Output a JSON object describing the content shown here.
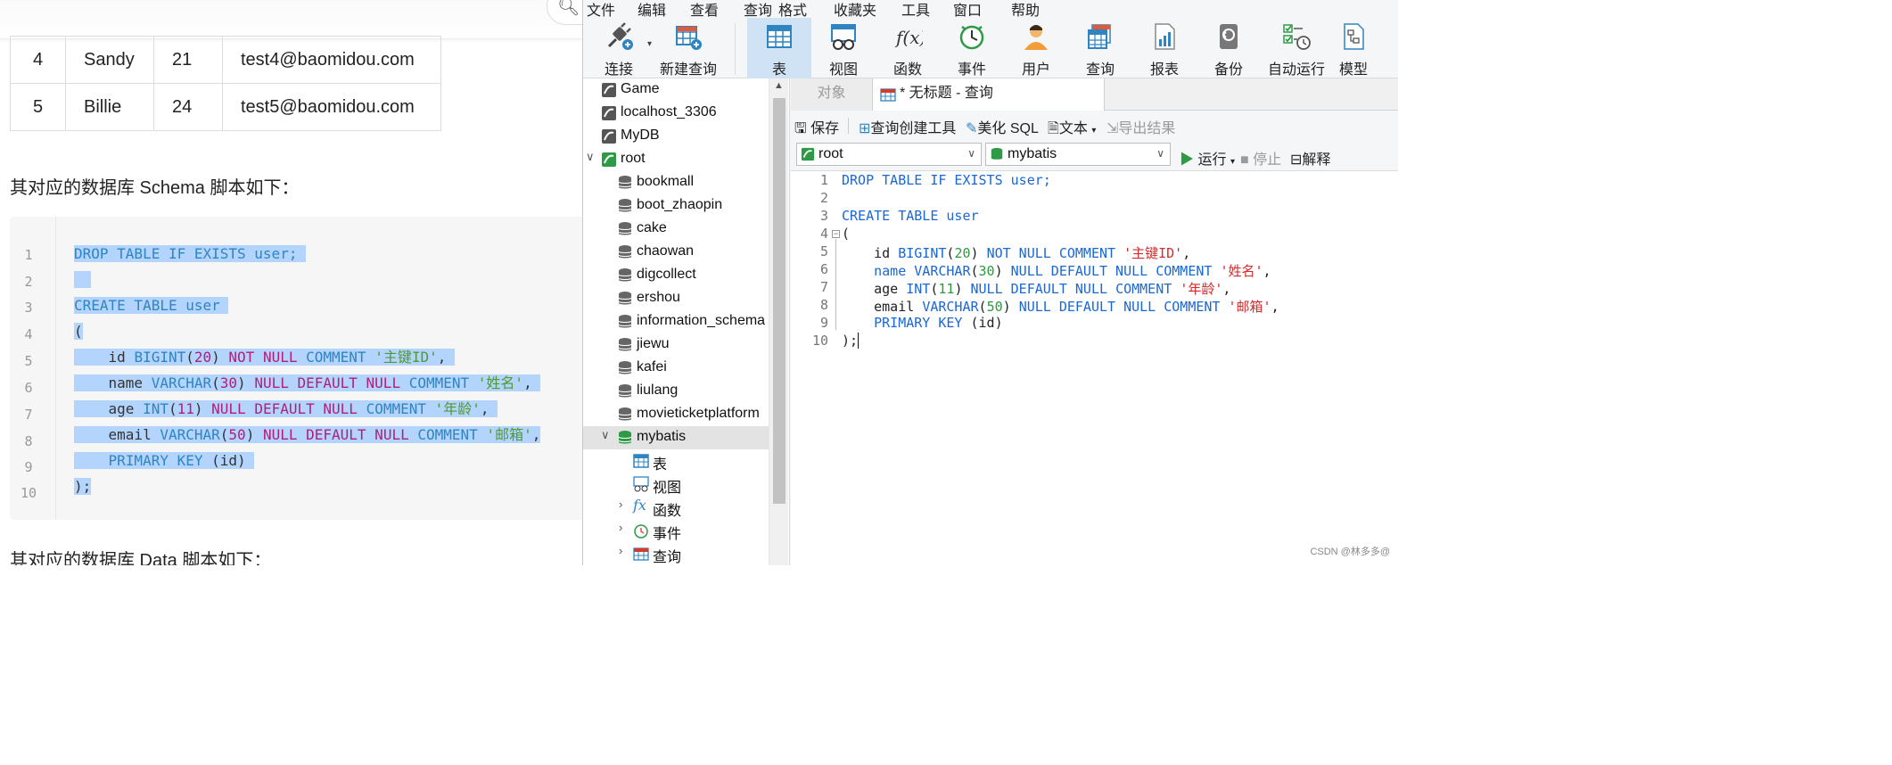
{
  "blog": {
    "table_rows": [
      {
        "id": "4",
        "name": "Sandy",
        "age": "21",
        "email": "test4@baomidou.com"
      },
      {
        "id": "5",
        "name": "Billie",
        "age": "24",
        "email": "test5@baomidou.com"
      }
    ],
    "schema_heading": "其对应的数据库 Schema 脚本如下：",
    "data_heading": "其对应的数据库 Data 脚本如下：",
    "code_line_numbers": [
      "1",
      "2",
      "3",
      "4",
      "5",
      "6",
      "7",
      "8",
      "9",
      "10"
    ]
  },
  "sql_tokens": {
    "drop": "DROP TABLE IF EXISTS user;",
    "create": "CREATE TABLE user",
    "open": "(",
    "close": ");",
    "id_col": "id",
    "id_type": "BIGINT",
    "id_len": "20",
    "not_null": "NOT NULL",
    "comment_kw": "COMMENT",
    "id_comment": "'主键ID'",
    "name_col": "name",
    "varchar": "VARCHAR",
    "name_len": "30",
    "null_default_null": "NULL DEFAULT NULL",
    "name_comment": "'姓名'",
    "age_col": "age",
    "int_type": "INT",
    "age_len": "11",
    "age_comment": "'年龄'",
    "email_col": "email",
    "email_len": "50",
    "email_comment": "'邮箱'",
    "pk": "PRIMARY KEY",
    "pk_col": "(id)"
  },
  "app": {
    "menu": [
      "文件",
      "编辑",
      "查看",
      "查询",
      "格式",
      "收藏夹",
      "工具",
      "窗口",
      "帮助"
    ],
    "toolbar": {
      "connect": "连接",
      "new_query": "新建查询",
      "table": "表",
      "view": "视图",
      "function": "函数",
      "event": "事件",
      "user": "用户",
      "query": "查询",
      "report": "报表",
      "backup": "备份",
      "automation": "自动运行",
      "model": "模型"
    },
    "nav": {
      "connections": [
        "Game",
        "localhost_3306",
        "MyDB",
        "root"
      ],
      "databases": [
        "bookmall",
        "boot_zhaopin",
        "cake",
        "chaowan",
        "digcollect",
        "ershou",
        "information_schema",
        "jiewu",
        "kafei",
        "liulang",
        "movieticketplatform",
        "mybatis"
      ],
      "mybatis_children": [
        "表",
        "视图",
        "函数",
        "事件",
        "查询"
      ]
    },
    "tabs": {
      "objects": "对象",
      "query_tab": "* 无标题 - 查询"
    },
    "editor_toolbar": {
      "save": "保存",
      "builder": "查询创建工具",
      "beautify": "美化 SQL",
      "text": "文本",
      "export": "导出结果"
    },
    "connection_select": "root",
    "database_select": "mybatis",
    "run": "运行",
    "stop": "停止",
    "explain": "解释",
    "watermark": "CSDN @林多多@"
  },
  "colors": {
    "accent": "#2f84c2",
    "selection": "#b3d4fc",
    "active_tool": "#cfe3f5",
    "navicat_green": "#2e9a46"
  }
}
